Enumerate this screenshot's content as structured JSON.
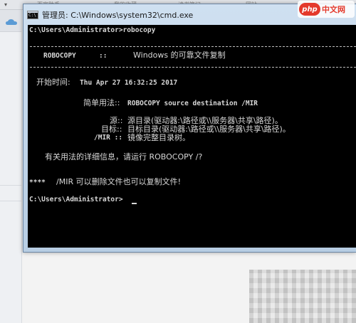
{
  "background": {
    "dropdown_glyph": "▾",
    "tab_texts": [
      "百家助手",
      "我的收藏",
      "读书笔记",
      "网站"
    ],
    "logo": {
      "mark": "php",
      "text": "中文网"
    }
  },
  "window": {
    "title": "管理员: C:\\Windows\\system32\\cmd.exe",
    "icon_text": "C:\\"
  },
  "console": {
    "prompt_command": "C:\\Users\\Administrator>robocopy",
    "header_left": "ROBOCOPY",
    "header_sep": "::",
    "header_right": "Windows 的可靠文件复制",
    "start_label": "开始时间:",
    "start_value": "Thu Apr 27 16:32:25 2017",
    "usage_label": "简单用法::",
    "usage_value": "ROBOCOPY source destination /MIR",
    "src_label": "源::",
    "src_value": "源目录(驱动器:\\路径或\\\\服务器\\共享\\路径)。",
    "dst_label": "目标::",
    "dst_value": "目标目录(驱动器:\\路径或\\\\服务器\\共享\\路径)。",
    "mir_label": "/MIR ::",
    "mir_value": "镜像完整目录树。",
    "help_line": "有关用法的详细信息，请运行 ROBOCOPY /?",
    "note_prefix": "****",
    "note_text": "/MIR 可以删除文件也可以复制文件!",
    "final_prompt": "C:\\Users\\Administrator>"
  },
  "colors": {
    "console_bg": "#000000",
    "console_fg": "#d7d7d7",
    "titlebar": "#cfe0f1",
    "logo_red": "#e43a2c"
  }
}
